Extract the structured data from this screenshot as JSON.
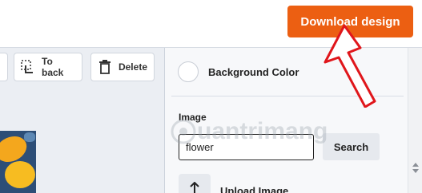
{
  "header": {
    "download_label": "Download design"
  },
  "toolbar": {
    "to_back_label": "To back",
    "delete_label": "Delete"
  },
  "panel": {
    "background_color_label": "Background Color",
    "image_label": "Image",
    "search_value": "flower",
    "search_button_label": "Search",
    "upload_label": "Upload Image"
  },
  "watermark": {
    "text": "uantrimang"
  },
  "colors": {
    "accent": "#ec5f12",
    "annotation": "#e0161b"
  },
  "icons": {
    "to_back": "send-to-back-icon",
    "delete": "trash-icon",
    "upload": "upload-arrow-icon"
  }
}
